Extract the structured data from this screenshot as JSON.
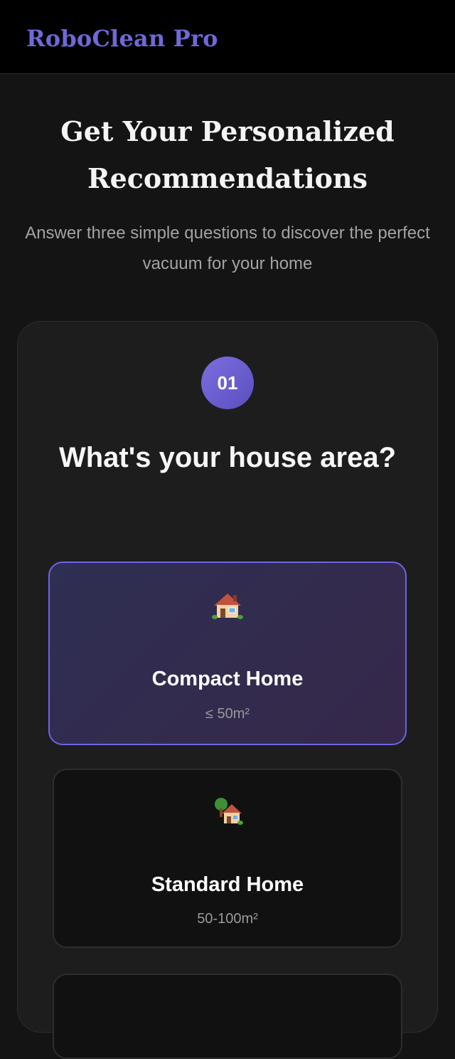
{
  "header": {
    "brand": "RoboClean Pro"
  },
  "hero": {
    "title": "Get Your Personalized Recommendations",
    "subtitle": "Answer three simple questions to discover the perfect vacuum for your home"
  },
  "quiz": {
    "step_number": "01",
    "question": "What's your house area?",
    "options": [
      {
        "icon": "house-icon",
        "title": "Compact Home",
        "subtitle": "≤ 50m²",
        "selected": true
      },
      {
        "icon": "house-with-garden-icon",
        "title": "Standard Home",
        "subtitle": "50-100m²",
        "selected": false
      }
    ]
  },
  "colors": {
    "brand": "#6f68d6",
    "accent": "#6d63e6",
    "background": "#141414",
    "card": "#1d1d1d"
  }
}
